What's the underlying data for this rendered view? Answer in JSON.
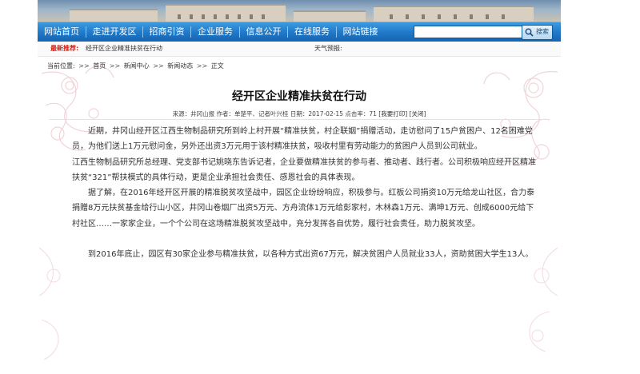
{
  "nav": {
    "items": [
      "网站首页",
      "走进开发区",
      "招商引资",
      "企业服务",
      "信息公开",
      "在线服务",
      "网站链接"
    ],
    "search_placeholder": "",
    "search_button": "搜索"
  },
  "infobar": {
    "latest_label": "最新推荐:",
    "latest_text": "经开区企业精准扶贫在行动",
    "weather_label": "天气预报:"
  },
  "breadcrumb": {
    "prefix": "当前位置:",
    "items": [
      "首页",
      "新闻中心",
      "新闻动态",
      "正文"
    ],
    "separator": ">>"
  },
  "article": {
    "title": "经开区企业精准扶贫在行动",
    "meta_text": "来源：井冈山报 作者：单楚平、记者叶兴桂 日期：2017-02-15 点击率：71",
    "print_link": "[我要打印]",
    "close_link": "[关闭]",
    "paragraphs": [
      "近期，井冈山经开区江西生物制品研究所到岭上村开展“精准扶贫，村企联姻”捐赠活动，走访慰问了15户贫困户、12名困难党员，为他们送上1万元慰问金，另外还出资3万元用于该村精准扶贫，吸收村里有劳动能力的贫困户人员到公司就业。",
      "江西生物制品研究所总经理、党支部书记姚晓东告诉记者，企业要做精准扶贫的参与者、推动者、践行者。公司积极响应经开区精准扶贫“321”帮扶模式的具体行动，更是企业承担社会责任、感恩社会的具体表现。",
      "据了解，在2016年经开区开展的精准脱贫攻坚战中，园区企业纷纷响应，积极参与。红板公司捐资10万元给龙山社区，合力泰捐赠8万元扶贫基金给行山小区，井冈山卷烟厂出资5万元、方舟流体1万元给彭家村，木林森1万元、满坤1万元、创成6000元给下村社区……一家家企业，一个个公司在这场精准脱贫攻坚战中，充分发挥各自优势，履行社会责任，助力脱贫攻坚。",
      "到2016年底止，园区有30家企业参与精准扶贫，以各种方式出资67万元，解决贫困户人员就业33人，资助贫困大学生13人。"
    ]
  },
  "colors": {
    "nav_blue": "#1f78c8",
    "latest_red": "#d1241a"
  }
}
